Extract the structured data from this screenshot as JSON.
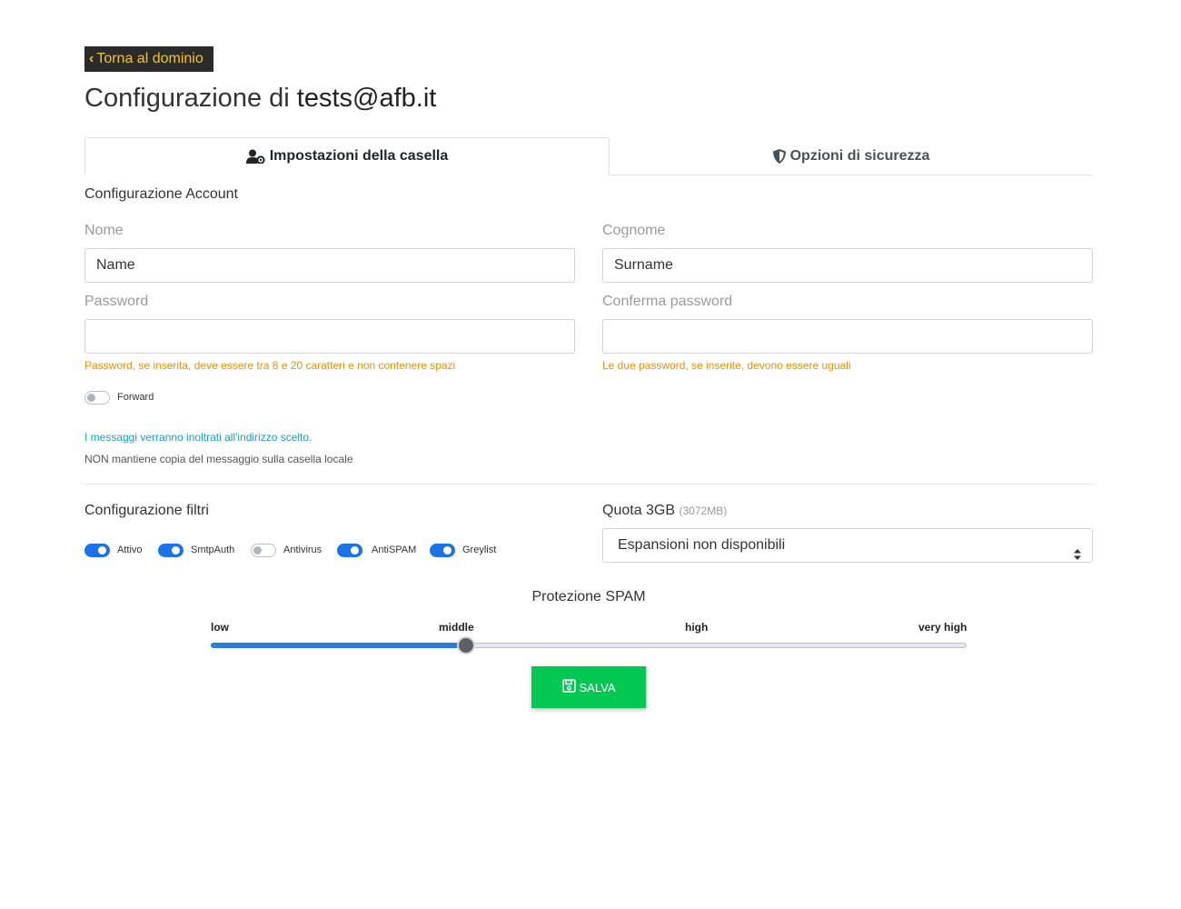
{
  "header": {
    "back_label": "Torna al dominio",
    "title_prefix": "Configurazione di",
    "title_email": "tests@afb.it"
  },
  "tabs": [
    {
      "label": "Impostazioni della casella",
      "active": true,
      "icon": "user-gear-icon"
    },
    {
      "label": "Opzioni di sicurezza",
      "active": false,
      "icon": "shield-icon"
    }
  ],
  "account": {
    "section_title": "Configurazione Account",
    "nome_label": "Nome",
    "nome_value": "Name",
    "cognome_label": "Cognome",
    "cognome_value": "Surname",
    "password_label": "Password",
    "password_value": "",
    "confirm_label": "Conferma password",
    "confirm_value": "",
    "password_warning": "Password, se inserita, deve essere tra 8 e 20 caratteri e non contenere spazi",
    "confirm_warning": "Le due password, se inserite, devono essere uguali"
  },
  "forward": {
    "label": "Forward",
    "enabled": false,
    "info": "I messaggi verranno inoltrati all'indirizzo scelto.",
    "note": "NON mantiene copia del messaggio sulla casella locale"
  },
  "filters": {
    "section_title": "Configurazione filtri",
    "items": [
      {
        "label": "Attivo",
        "enabled": true
      },
      {
        "label": "SmtpAuth",
        "enabled": true
      },
      {
        "label": "Antivirus",
        "enabled": false
      },
      {
        "label": "AntiSPAM",
        "enabled": true
      },
      {
        "label": "Greylist",
        "enabled": true
      }
    ]
  },
  "quota": {
    "label": "Quota 3GB",
    "detail": "(3072MB)",
    "selected": "Espansioni non disponibili"
  },
  "spam": {
    "title": "Protezione SPAM",
    "levels": [
      "low",
      "middle",
      "high",
      "very high"
    ],
    "selected_level": "middle",
    "selected_index": 1
  },
  "actions": {
    "save_label": "SALVA"
  },
  "colors": {
    "accent": "#1a73e8",
    "save": "#00c853",
    "warning": "#e8900c",
    "info": "#17a2b8"
  }
}
